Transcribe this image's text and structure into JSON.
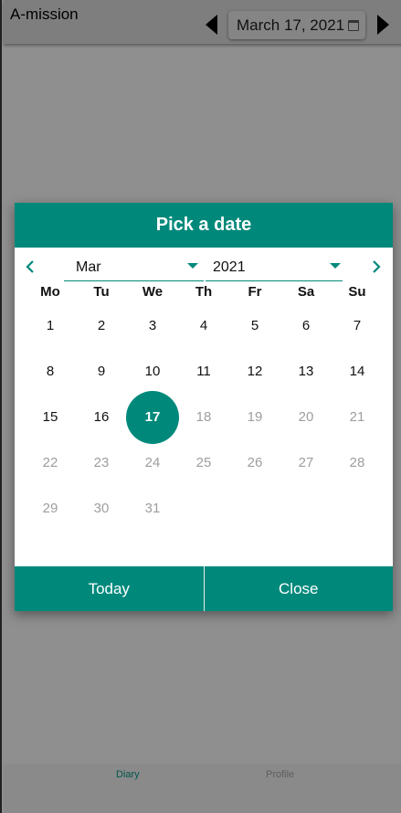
{
  "appbar": {
    "title": "A-mission",
    "date_label": "March 17, 2021",
    "date_icon": "calendar-icon",
    "prev_icon": "triangle-left-icon",
    "next_icon": "triangle-right-icon"
  },
  "bottom_nav": {
    "items": [
      {
        "label": "Diary",
        "active": true
      },
      {
        "label": "Profile",
        "active": false
      }
    ]
  },
  "dialog": {
    "title": "Pick a date",
    "month_value": "Mar",
    "year_value": "2021",
    "weekdays": [
      "Mo",
      "Tu",
      "We",
      "Th",
      "Fr",
      "Sa",
      "Su"
    ],
    "days": [
      "1",
      "2",
      "3",
      "4",
      "5",
      "6",
      "7",
      "8",
      "9",
      "10",
      "11",
      "12",
      "13",
      "14",
      "15",
      "16",
      "17",
      "18",
      "19",
      "20",
      "21",
      "22",
      "23",
      "24",
      "25",
      "26",
      "27",
      "28",
      "29",
      "30",
      "31"
    ],
    "selected_day": "17",
    "first_weekday_index": 0,
    "today_label": "Today",
    "close_label": "Close"
  },
  "colors": {
    "accent": "#00897b",
    "overlay": "#8f8f8f",
    "disabled_text": "#9e9e9e"
  }
}
